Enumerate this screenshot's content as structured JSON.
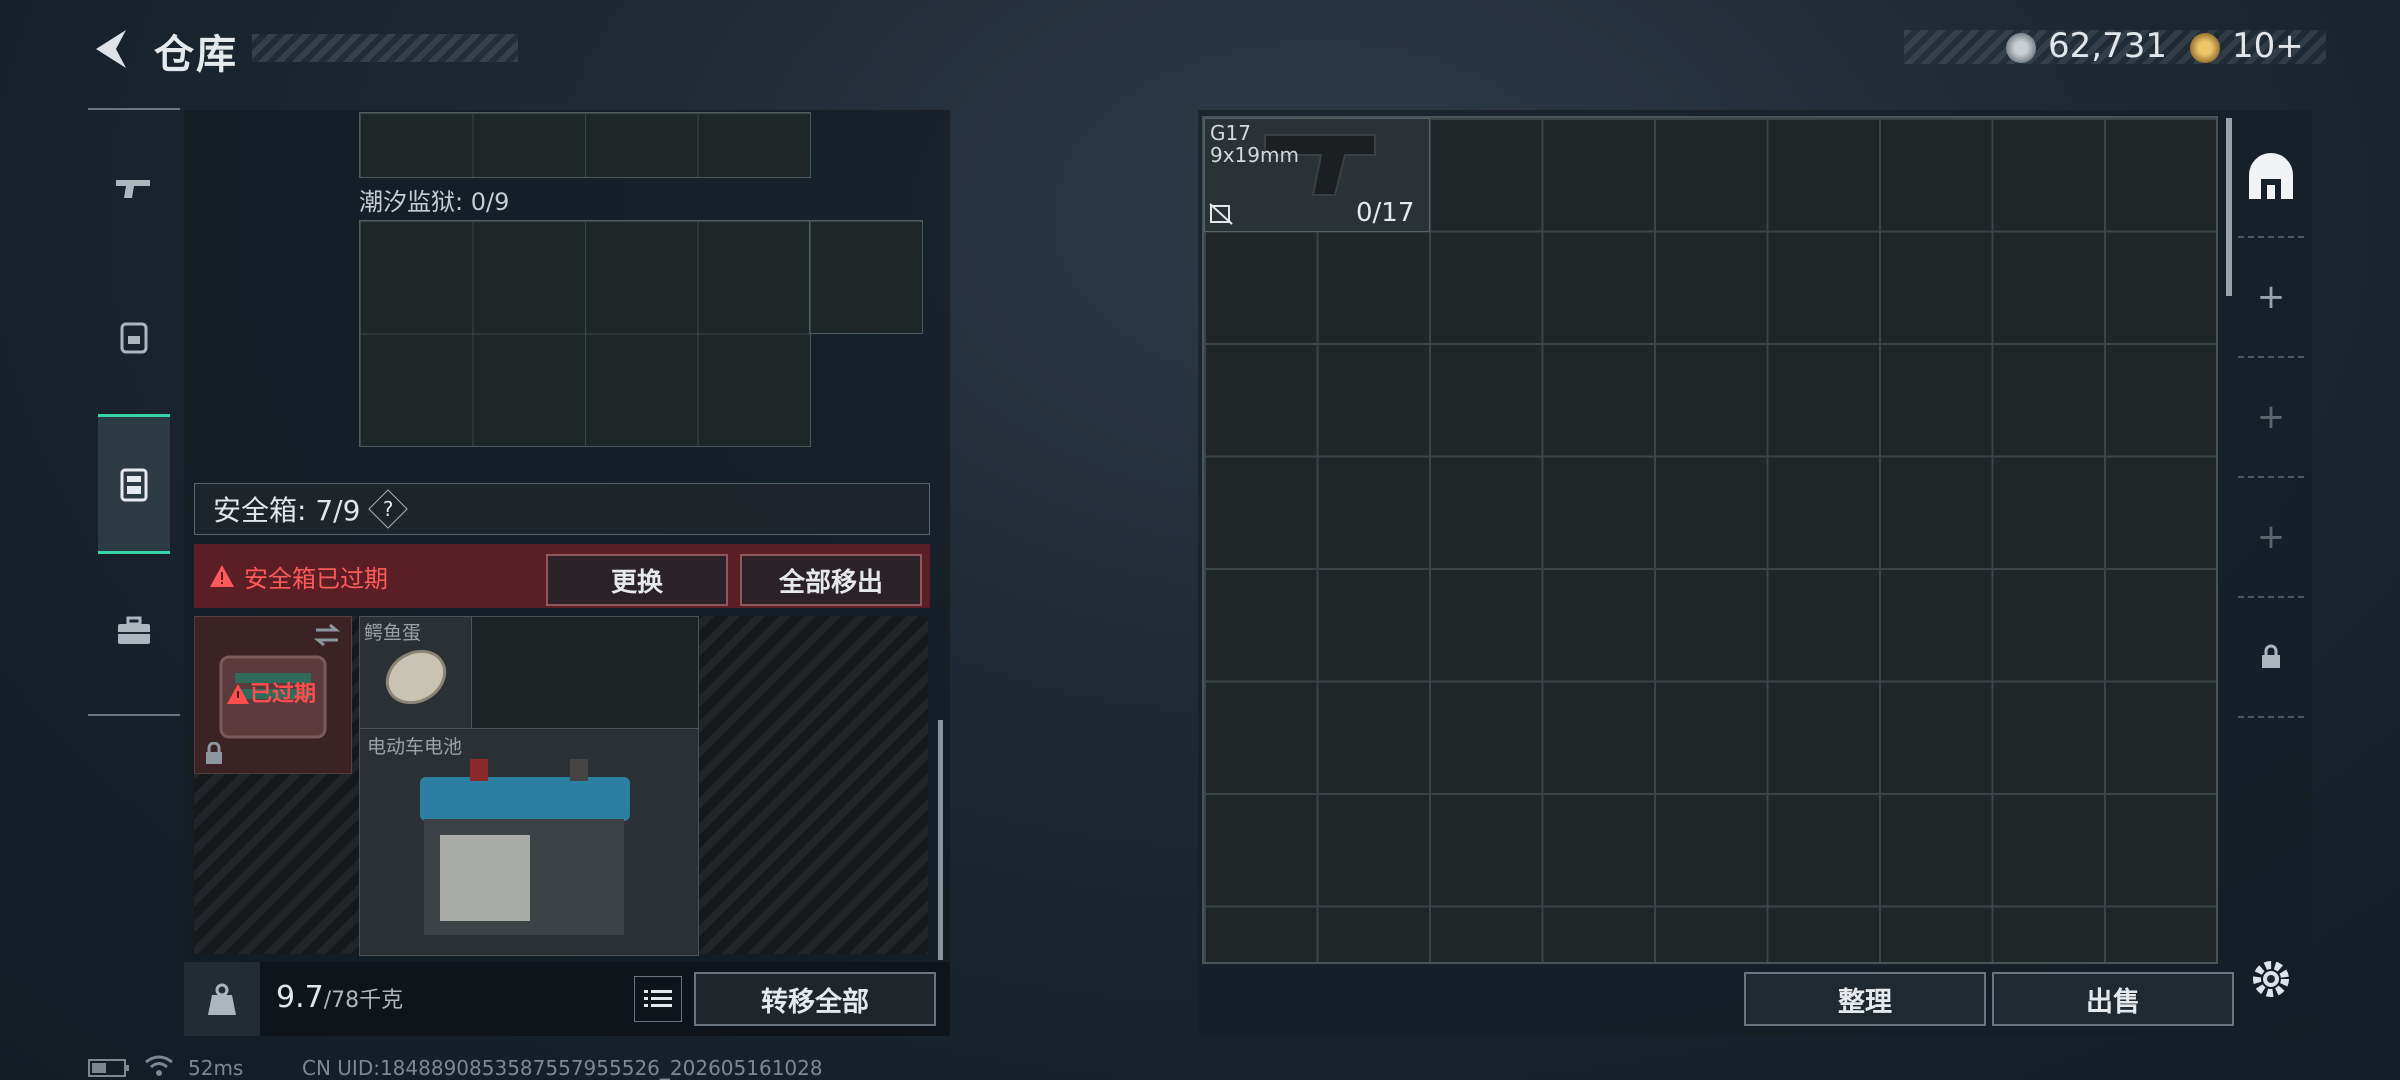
{
  "header": {
    "title": "仓库",
    "currency_1": "62,731",
    "currency_2": "10+"
  },
  "side_tabs": [
    "weapon-icon",
    "backpack-icon",
    "safe-case-icon",
    "toolbox-icon"
  ],
  "left_panel": {
    "container_label": "潮汐监狱: 0/9",
    "safe_box": {
      "title": "安全箱: 7/9",
      "help": "?",
      "warning": "安全箱已过期",
      "replace_button": "更换",
      "remove_all_button": "全部移出",
      "expired_badge": "已过期",
      "items": [
        {
          "name": "鳄鱼蛋"
        },
        {
          "name": "电动车电池"
        }
      ]
    },
    "weight": {
      "current": "9.7",
      "max": "/78千克"
    },
    "transfer_all_button": "转移全部"
  },
  "stash": {
    "item": {
      "name": "G17",
      "caliber": "9x19mm",
      "ammo": "0/17"
    },
    "sort_button": "整理",
    "sell_button": "出售"
  },
  "status_bar": {
    "ping": "52ms",
    "uid": "CN UID:1848890853587557955526_202605161028"
  },
  "colors": {
    "accent_green": "#37d4a6",
    "warning_red": "#ff5a5a",
    "warning_bg": "#5a1e24"
  }
}
